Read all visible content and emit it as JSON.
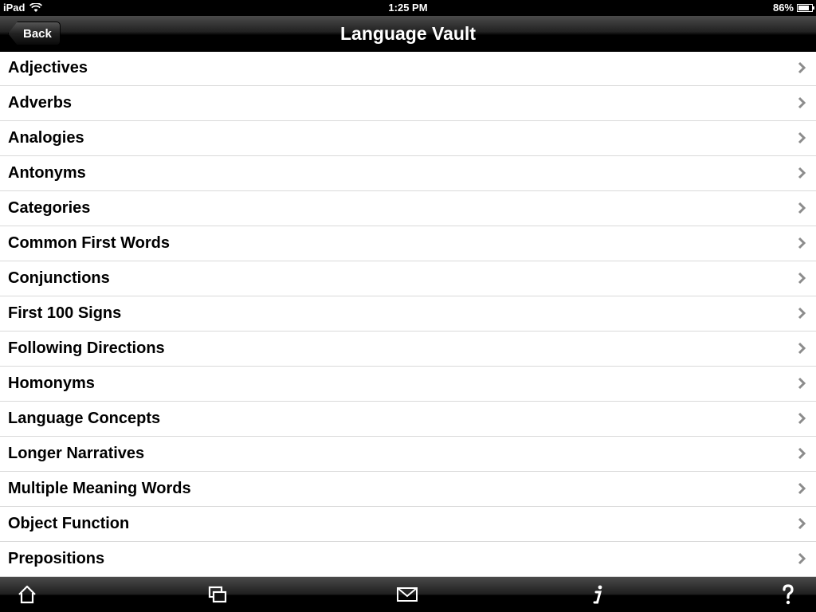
{
  "status_bar": {
    "device": "iPad",
    "time": "1:25 PM",
    "battery_text": "86%",
    "battery_level": 0.86
  },
  "nav": {
    "title": "Language Vault",
    "back_label": "Back"
  },
  "list": {
    "items": [
      {
        "label": "Adjectives"
      },
      {
        "label": "Adverbs"
      },
      {
        "label": "Analogies"
      },
      {
        "label": "Antonyms"
      },
      {
        "label": "Categories"
      },
      {
        "label": "Common First Words"
      },
      {
        "label": "Conjunctions"
      },
      {
        "label": "First 100 Signs"
      },
      {
        "label": "Following Directions"
      },
      {
        "label": "Homonyms"
      },
      {
        "label": "Language Concepts"
      },
      {
        "label": "Longer Narratives"
      },
      {
        "label": "Multiple Meaning Words"
      },
      {
        "label": "Object Function"
      },
      {
        "label": "Prepositions"
      }
    ]
  },
  "toolbar": {
    "icons": [
      "home-icon",
      "windows-icon",
      "mail-icon",
      "info-icon",
      "help-icon"
    ]
  },
  "colors": {
    "bar_background": "#000000",
    "row_separator": "#d9d9d9",
    "chevron": "#8c8c8c"
  }
}
